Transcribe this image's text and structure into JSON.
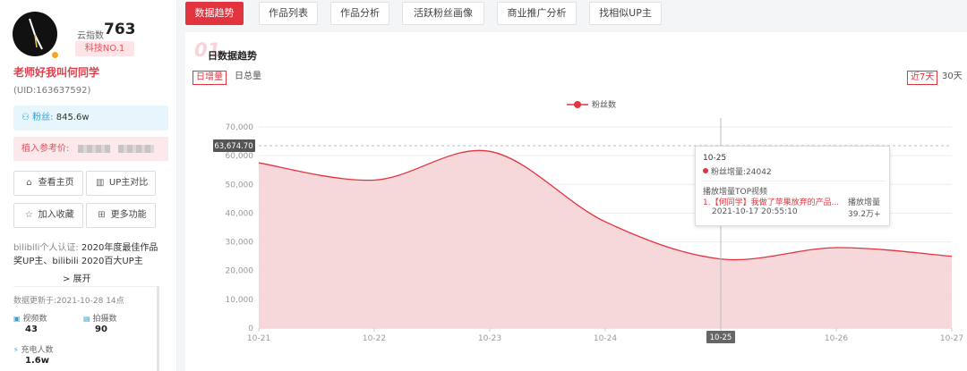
{
  "sidebar": {
    "cloud_index_label": "云指数",
    "cloud_index_value": "763",
    "rank_badge": "科技NO.1",
    "username": "老师好我叫何同学",
    "uid": "(UID:163637592)",
    "fans_label": "粉丝:",
    "fans_value": "845.6w",
    "quote_label": "植入参考价:",
    "buttons": [
      {
        "label": "查看主页",
        "icon": "home-icon"
      },
      {
        "label": "UP主对比",
        "icon": "compare-icon"
      },
      {
        "label": "加入收藏",
        "icon": "star-icon"
      },
      {
        "label": "更多功能",
        "icon": "grid-icon"
      }
    ],
    "cert_label": "bilibili个人认证:",
    "cert_line1": "2020年度最佳作品",
    "cert_line2": "奖UP主、bilibili 2020百大UP主",
    "expand_label": "> 展开",
    "update_text": "数据更新于:2021-10-28 14点",
    "stats": [
      {
        "label": "视频数",
        "value": "43"
      },
      {
        "label": "拍摄数",
        "value": "90"
      },
      {
        "label": "充电人数",
        "value": "1.6w"
      }
    ]
  },
  "tabs": [
    "数据趋势",
    "作品列表",
    "作品分析",
    "活跃粉丝画像",
    "商业推广分析",
    "找相似UP主"
  ],
  "active_tab": 0,
  "panel": {
    "title": "日数据趋势",
    "deco": "01",
    "seg_left": [
      "日增量",
      "日总量"
    ],
    "seg_right": [
      "近7天",
      "30天"
    ],
    "legend": "粉丝数",
    "cursor_value_label": "63,674.70",
    "cursor_x_label": "10-25"
  },
  "tooltip": {
    "date": "10-25",
    "fans_label": "粉丝增量:",
    "fans_value": "24042",
    "top_label": "播放增量TOP视频",
    "video_title": "1.【何同学】我做了苹果放弃的产品...",
    "video_time": "2021-10-17 20:55:10",
    "play_label": "播放增量",
    "play_value": "39.2万+"
  },
  "chart_data": {
    "type": "area",
    "x": [
      "10-21",
      "10-22",
      "10-23",
      "10-24",
      "10-25",
      "10-26",
      "10-27"
    ],
    "series": [
      {
        "name": "粉丝数",
        "values": [
          57500,
          51500,
          61500,
          37000,
          24042,
          28000,
          25000
        ]
      }
    ],
    "ylim": [
      0,
      70000
    ],
    "yticks": [
      "0",
      "10,000",
      "20,000",
      "30,000",
      "40,000",
      "50,000",
      "60,000",
      "70,000"
    ],
    "grid": true,
    "legend_position": "top-center",
    "colors": {
      "line": "#e2343f",
      "fill": "#f6d5d8"
    }
  }
}
